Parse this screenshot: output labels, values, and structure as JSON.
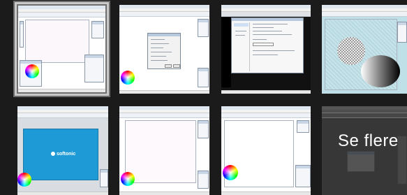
{
  "gallery": {
    "thumbnails": [
      {
        "id": "thumb-1",
        "selected": true
      },
      {
        "id": "thumb-2",
        "selected": false
      },
      {
        "id": "thumb-3",
        "selected": false
      },
      {
        "id": "thumb-4",
        "selected": false
      },
      {
        "id": "thumb-5",
        "selected": false
      },
      {
        "id": "thumb-6",
        "selected": false
      },
      {
        "id": "thumb-7",
        "selected": false
      },
      {
        "id": "thumb-8",
        "selected": false
      }
    ],
    "see_more_label": "Se flere",
    "watermark_brand": "softonic"
  },
  "colors": {
    "background": "#1b1b1b",
    "selected_border": "#c9c9c9",
    "softonic_blue": "#1e9ad6"
  }
}
